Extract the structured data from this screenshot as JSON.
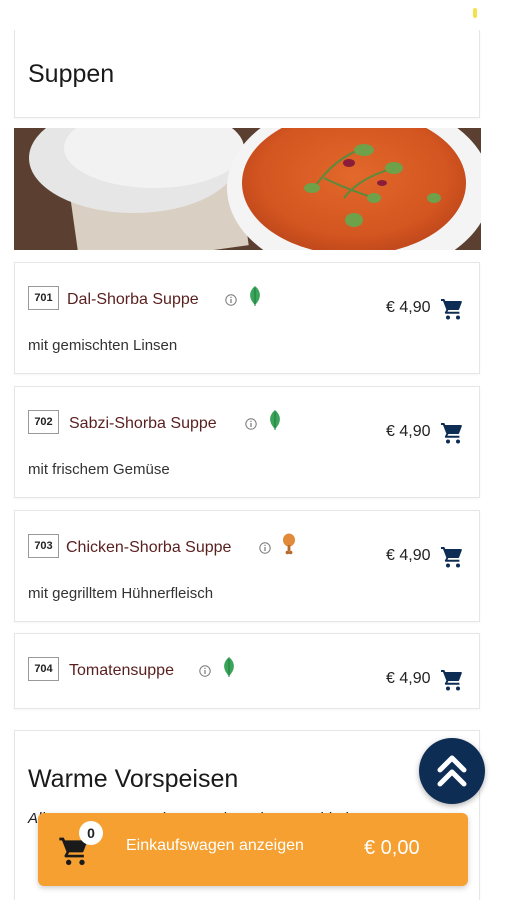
{
  "section": {
    "title": "Suppen"
  },
  "items": [
    {
      "number": "701",
      "name": "Dal-Shorba Suppe",
      "description": "mit gemischten Linsen",
      "price": "€ 4,90",
      "diet_icon": "leaf-icon"
    },
    {
      "number": "702",
      "name": "Sabzi-Shorba Suppe",
      "description": "mit frischem Gemüse",
      "price": "€ 4,90",
      "diet_icon": "leaf-icon"
    },
    {
      "number": "703",
      "name": "Chicken-Shorba Suppe",
      "description": "mit gegrilltem Hühnerfleisch",
      "price": "€ 4,90",
      "diet_icon": "chicken-leg-icon"
    },
    {
      "number": "704",
      "name": "Tomatensuppe",
      "description": "",
      "price": "€ 4,90",
      "diet_icon": "leaf-icon"
    }
  ],
  "next_section": {
    "title": "Warme Vorspeisen",
    "description": "Alle warmen Vorspeisen werden mit 2 verschiedenen so K"
  },
  "cart": {
    "count": "0",
    "label": "Einkaufswagen anzeigen",
    "total": "€ 0,00"
  },
  "colors": {
    "accent_orange": "#f5a030",
    "navy": "#0e2d55",
    "item_name": "#5a1f1f",
    "veg_green": "#3aa55a",
    "chicken_orange": "#e08a3a"
  }
}
